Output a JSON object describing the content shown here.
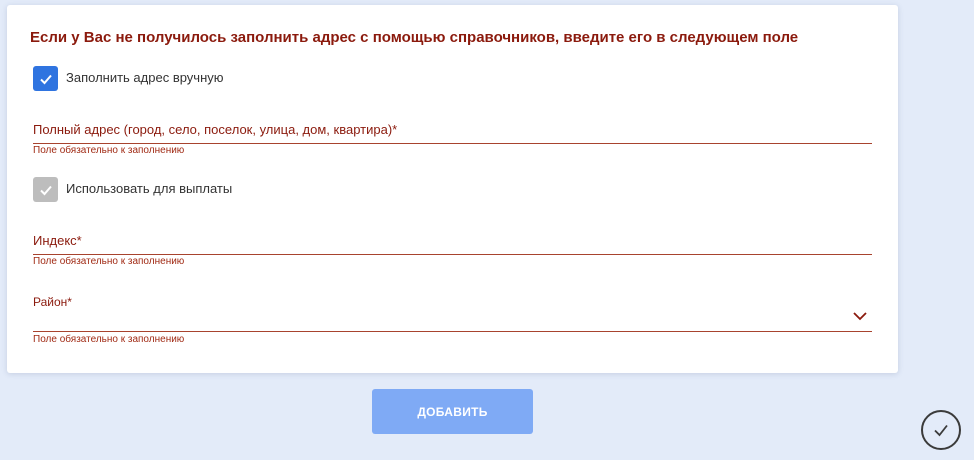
{
  "form": {
    "title": "Если у Вас не получилось заполнить адрес с помощью справочников, введите его в следующем поле",
    "manual_address": {
      "label": "Заполнить адрес вручную",
      "checked": true,
      "color": "#2f74e0"
    },
    "full_address": {
      "label": "Полный адрес (город, село, поселок, улица, дом, квартира)*",
      "value": "",
      "error": "Поле обязательно к заполнению"
    },
    "use_for_payment": {
      "label": "Использовать для выплаты",
      "checked": true,
      "disabled": true
    },
    "index": {
      "label": "Индекс*",
      "value": "",
      "error": "Поле обязательно к заполнению"
    },
    "district": {
      "label": "Район*",
      "selected": "",
      "error": "Поле обязательно к заполнению",
      "icon": "chevron-down-icon"
    }
  },
  "actions": {
    "add_label": "ДОБАВИТЬ"
  },
  "status": {
    "icon": "check-circle-icon"
  },
  "colors": {
    "background": "#e3ebf9",
    "error_text": "#8b1a0d",
    "button": "#7faaf5"
  }
}
